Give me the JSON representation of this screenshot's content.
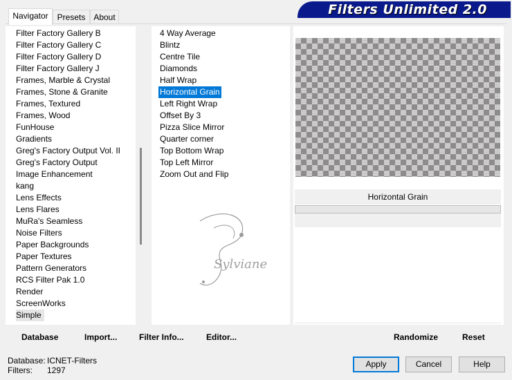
{
  "tabs": [
    "Navigator",
    "Presets",
    "About"
  ],
  "banner": {
    "title": "Filters Unlimited 2.0"
  },
  "categories": [
    "Filter Factory Gallery B",
    "Filter Factory Gallery C",
    "Filter Factory Gallery D",
    "Filter Factory Gallery J",
    "Frames, Marble & Crystal",
    "Frames, Stone & Granite",
    "Frames, Textured",
    "Frames, Wood",
    "FunHouse",
    "Gradients",
    "Greg's Factory Output Vol. II",
    "Greg's Factory Output",
    "Image Enhancement",
    "kang",
    "Lens Effects",
    "Lens Flares",
    "MuRa's Seamless",
    "Noise Filters",
    "Paper Backgrounds",
    "Paper Textures",
    "Pattern Generators",
    "RCS Filter Pak 1.0",
    "Render",
    "ScreenWorks",
    "Simple"
  ],
  "selected_category": "Simple",
  "filters": [
    "4 Way Average",
    "Blintz",
    "Centre Tile",
    "Diamonds",
    "Half Wrap",
    "Horizontal Grain",
    "Left Right Wrap",
    "Offset By 3",
    "Pizza Slice Mirror",
    "Quarter corner",
    "Top Bottom Wrap",
    "Top Left Mirror",
    "Zoom Out and Flip"
  ],
  "selected_filter": "Horizontal Grain",
  "filter_title": "Horizontal Grain",
  "watermark_text": "Sylviane",
  "toolbar": {
    "database": "Database",
    "import": "Import...",
    "filter_info": "Filter Info...",
    "editor": "Editor...",
    "randomize": "Randomize",
    "reset": "Reset"
  },
  "status": {
    "database_label": "Database:",
    "database_value": "ICNET-Filters",
    "filters_label": "Filters:",
    "filters_value": "1297"
  },
  "buttons": {
    "apply": "Apply",
    "cancel": "Cancel",
    "help": "Help"
  }
}
